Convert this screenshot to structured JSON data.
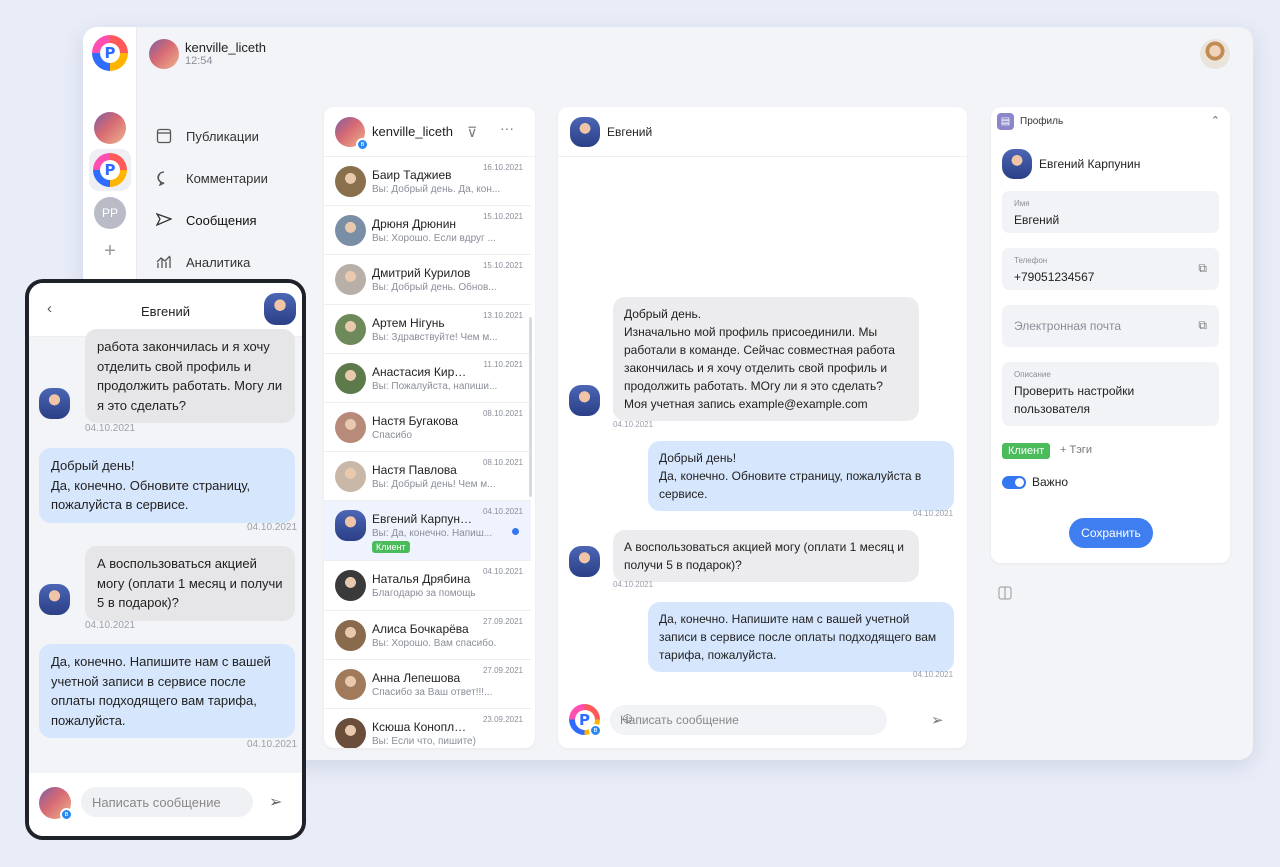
{
  "app": {
    "account": {
      "name": "kenville_liceth",
      "time": "12:54"
    },
    "rail": {
      "initials": "PP",
      "add": "+"
    },
    "nav": [
      {
        "label": "Публикации",
        "icon": "publications-icon"
      },
      {
        "label": "Комментарии",
        "icon": "comment-icon"
      },
      {
        "label": "Сообщения",
        "icon": "send-icon"
      },
      {
        "label": "Аналитика",
        "icon": "analytics-icon"
      }
    ]
  },
  "list": {
    "title": "kenville_liceth",
    "filter": "⊽",
    "more": "···",
    "rows": [
      {
        "name": "Баир Таджиев",
        "preview": "Вы: Добрый день. Да, кон...",
        "date": "16.10.2021"
      },
      {
        "name": "Дрюня Дрюнин",
        "preview": "Вы: Хорошо. Если вдруг ...",
        "date": "15.10.2021"
      },
      {
        "name": "Дмитрий Курилов",
        "preview": "Вы: Добрый день. Обнов...",
        "date": "15.10.2021"
      },
      {
        "name": "Артем Нiгунь",
        "preview": "Вы: Здравствуйте! Чем м...",
        "date": "13.10.2021"
      },
      {
        "name": "Анастасия Кирилова",
        "preview": "Вы: Пожалуйста, напиши...",
        "date": "11.10.2021"
      },
      {
        "name": "Настя Бугакова",
        "preview": "Спасибо",
        "date": "08.10.2021"
      },
      {
        "name": "Настя Павлова",
        "preview": "Вы: Добрый день! Чем м...",
        "date": "08.10.2021"
      },
      {
        "name": "Евгений Карпунин",
        "preview": "Вы: Да, конечно. Напиш...",
        "date": "04.10.2021",
        "tag": "Клиент"
      },
      {
        "name": "Наталья Дрябина",
        "preview": "Благодарю за помощь",
        "date": "04.10.2021"
      },
      {
        "name": "Алиса Бочкарёва",
        "preview": "Вы: Хорошо. Вам спасибо.",
        "date": "27.09.2021"
      },
      {
        "name": "Анна Лепешова",
        "preview": "Спасибо за Ваш ответ!!!...",
        "date": "27.09.2021"
      },
      {
        "name": "Ксюша Коноплева",
        "preview": "Вы: Если что, пишите)",
        "date": "23.09.2021"
      }
    ]
  },
  "chat": {
    "title": "Евгений",
    "messages": [
      {
        "text": "Добрый день.\nИзначально мой профиль присоединили. Мы работали в команде. Сейчас совместная работа закончилась и я хочу отделить свой профиль и продолжить работать. МОгу ли я это сделать?\nМоя учетная запись example@example.com",
        "time": "04.10.2021"
      },
      {
        "text": "Добрый день!\nДа, конечно. Обновите страницу, пожалуйста в сервисе.",
        "time": "04.10.2021"
      },
      {
        "text": "А воспользоваться акцией могу (оплати 1 месяц и получи 5 в подарок)?",
        "time": "04.10.2021"
      },
      {
        "text": "Да, конечно. Напишите нам с вашей учетной записи в сервисе после оплаты подходящего вам тарифа, пожалуйста.",
        "time": "04.10.2021"
      }
    ],
    "placeholder": "Написать сообщение",
    "emoji": "☺",
    "send": "➢"
  },
  "profile": {
    "header": "Профиль",
    "chevron": "⌃",
    "user": "Евгений Карпунин",
    "name_label": "Имя",
    "name_value": "Евгений",
    "phone_label": "Телефон",
    "phone_value": "+79051234567",
    "email_placeholder": "Электронная почта",
    "desc_label": "Описание",
    "desc_value": "Проверить настройки\nпользователя",
    "tag": "Клиент",
    "add_tag": "+ Тэги",
    "important": "Важно",
    "save": "Сохранить"
  },
  "phone": {
    "title": "Евгений",
    "back": "‹",
    "messages": [
      {
        "text": "работа закончилась и я хочу отделить свой профиль и продолжить работать. Могу ли я это сделать?",
        "time": "04.10.2021"
      },
      {
        "text": "Добрый день!\nДа, конечно. Обновите страницу, пожалуйста в сервисе.",
        "time": "04.10.2021"
      },
      {
        "text": "А воспользоваться акцией могу (оплати 1 месяц и получи 5 в подарок)?",
        "time": "04.10.2021"
      },
      {
        "text": "Да, конечно. Напишите нам с вашей учетной записи в сервисе после оплаты подходящего вам тарифа, пожалуйста.",
        "time": "04.10.2021"
      }
    ],
    "placeholder": "Написать сообщение",
    "send": "➢"
  }
}
